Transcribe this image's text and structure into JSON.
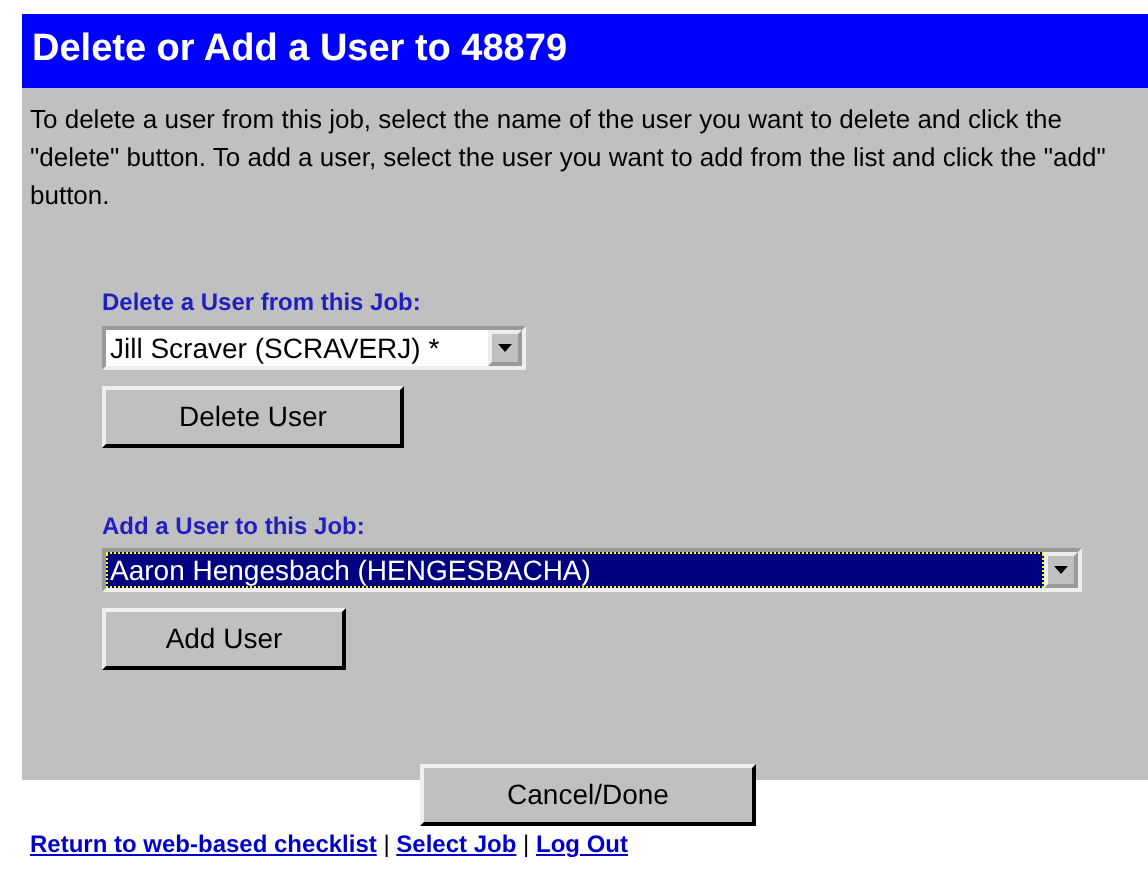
{
  "header": {
    "title": "Delete or Add a User to 48879"
  },
  "instructions": "To delete a user from this job, select the name of the user you want to delete and click the \"delete\" button. To add a user, select the user you want to add from the list and click the \"add\" button.",
  "sections": [
    {
      "label": "Delete a User from this Job:",
      "select": {
        "value": "Jill Scraver (SCRAVERJ) *",
        "focused": false,
        "wide": false
      },
      "button": "Delete User"
    },
    {
      "label": "Add a User to this Job:",
      "select": {
        "value": "Aaron Hengesbach (HENGESBACHA)",
        "focused": true,
        "wide": true
      },
      "button": "Add User"
    }
  ],
  "cancel_button": "Cancel/Done",
  "footer_links": [
    {
      "label": "Return to web-based checklist"
    },
    {
      "label": "Select Job"
    },
    {
      "label": "Log Out"
    }
  ],
  "separator": "|"
}
